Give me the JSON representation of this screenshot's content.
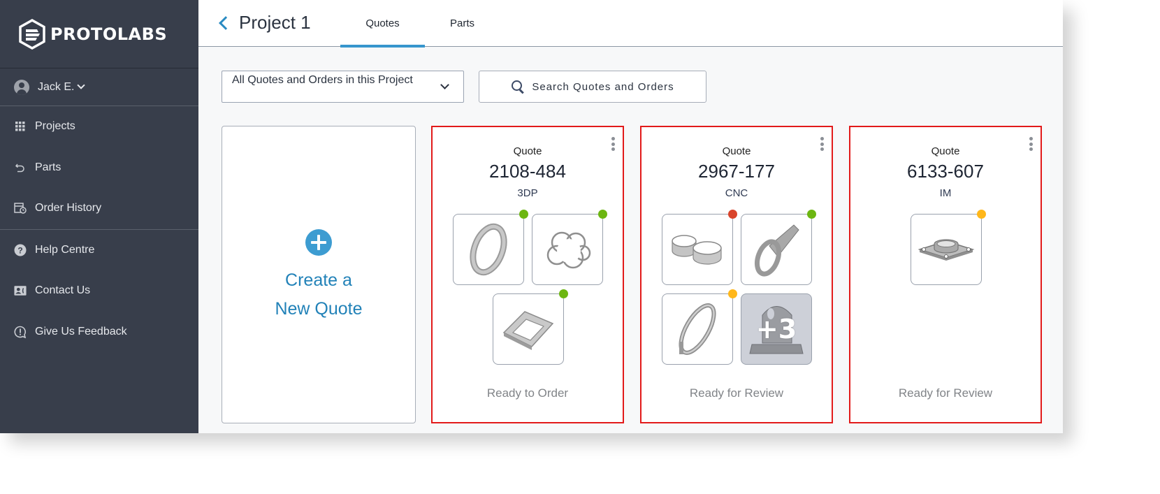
{
  "brand": {
    "name": "PROTOLABS"
  },
  "user": {
    "name": "Jack E."
  },
  "sidebar": {
    "groups": [
      {
        "items": [
          {
            "label": "Projects",
            "icon": "grid-icon"
          },
          {
            "label": "Parts",
            "icon": "undo-arrow-icon"
          },
          {
            "label": "Order History",
            "icon": "history-calendar-icon"
          }
        ]
      },
      {
        "items": [
          {
            "label": "Help Centre",
            "icon": "help-question-icon"
          },
          {
            "label": "Contact Us",
            "icon": "contact-card-icon"
          },
          {
            "label": "Give Us Feedback",
            "icon": "feedback-bubble-icon"
          }
        ]
      }
    ]
  },
  "header": {
    "title": "Project 1",
    "tabs": [
      {
        "label": "Quotes",
        "active": true
      },
      {
        "label": "Parts",
        "active": false
      }
    ]
  },
  "toolbar": {
    "filter_value": "All Quotes and Orders in this Project",
    "search_label": "Search Quotes and Orders"
  },
  "new_quote": {
    "label_line1": "Create a",
    "label_line2": "New Quote"
  },
  "status_colors": {
    "green": "#6cb611",
    "red": "#d9442b",
    "yellow": "#ffb71a"
  },
  "quotes": [
    {
      "kind": "Quote",
      "number": "2108-484",
      "process": "3DP",
      "status": "Ready to Order",
      "parts": [
        {
          "shape": "ring-bracket",
          "status": "green"
        },
        {
          "shape": "flower-frame",
          "status": "green"
        },
        {
          "shape": "rect-frame",
          "status": "green"
        }
      ]
    },
    {
      "kind": "Quote",
      "number": "2967-177",
      "process": "CNC",
      "status": "Ready for Review",
      "parts": [
        {
          "shape": "double-ring",
          "status": "red"
        },
        {
          "shape": "arm-ring",
          "status": "green"
        },
        {
          "shape": "clamp-ring",
          "status": "yellow"
        }
      ],
      "more_count": "+3"
    },
    {
      "kind": "Quote",
      "number": "6133-607",
      "process": "IM",
      "status": "Ready for Review",
      "parts": [
        {
          "shape": "flange",
          "status": "yellow"
        }
      ]
    }
  ]
}
